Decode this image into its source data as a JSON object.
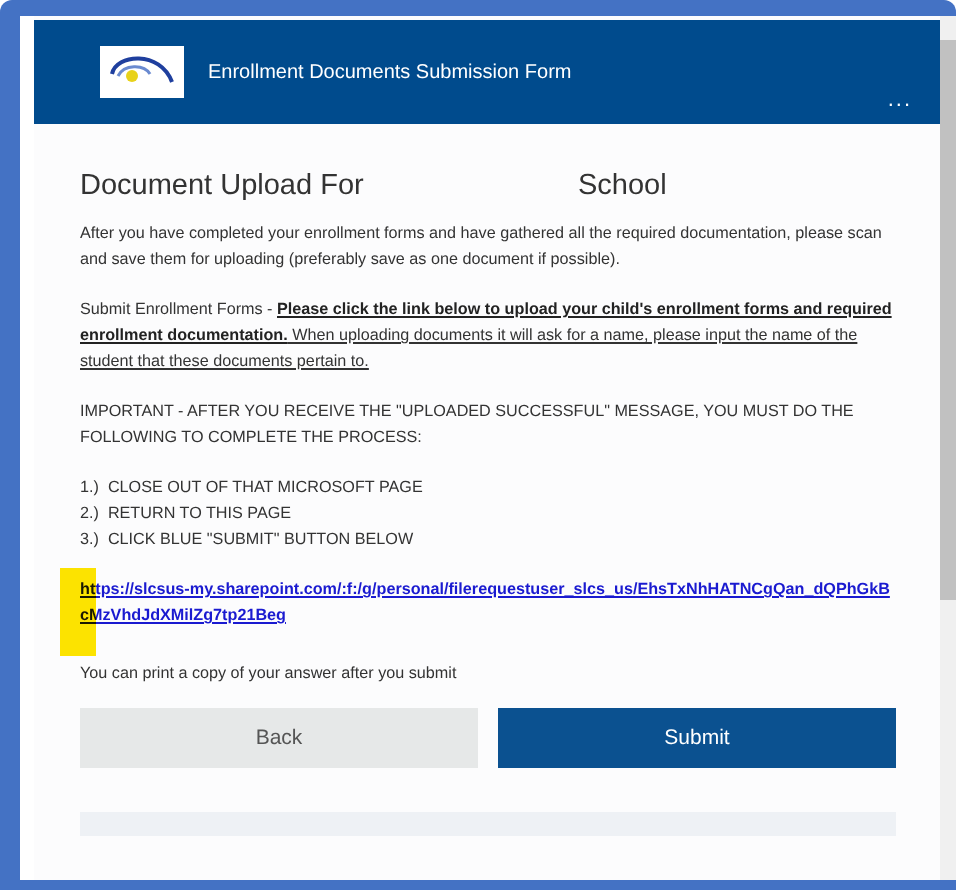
{
  "header": {
    "title": "Enrollment Documents Submission Form",
    "more": "..."
  },
  "heading": {
    "left": "Document Upload For",
    "right": "School"
  },
  "intro": "After you have completed your enrollment forms and have gathered all the required documentation, please scan and save them for uploading (preferably save as one document if possible).",
  "instructions": [
    {
      "kind": "plain",
      "text": "Submit Enrollment Forms - "
    },
    {
      "kind": "strong",
      "text": "Please click the link below to upload your child's enrollment forms and required enrollment documentation."
    },
    {
      "kind": "underline",
      "text": " When uploading documents it will ask for a name, please input the name of the student that these documents pertain to."
    }
  ],
  "important": "IMPORTANT - AFTER YOU RECEIVE THE \"UPLOADED SUCCESSFUL\" MESSAGE, YOU MUST DO THE FOLLOWING TO COMPLETE THE PROCESS:",
  "steps": [
    "1.)  CLOSE OUT OF THAT MICROSOFT PAGE",
    "2.)  RETURN TO THIS PAGE",
    "3.)  CLICK BLUE \"SUBMIT\" BUTTON BELOW"
  ],
  "link": "https://slcsus-my.sharepoint.com/:f:/g/personal/filerequestuser_slcs_us/EhsTxNhHATNCgQan_dQPhGkBcMzVhdJdXMilZg7tp21Beg",
  "print_note": "You can print a copy of your answer after you submit",
  "buttons": [
    {
      "label": "Back",
      "kind": "secondary"
    },
    {
      "label": "Submit",
      "kind": "primary"
    }
  ]
}
